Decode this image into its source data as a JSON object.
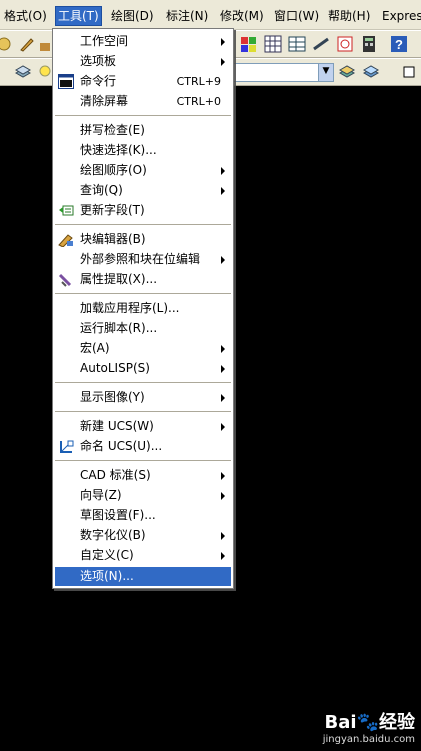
{
  "menubar": {
    "items": [
      {
        "label": "格式(O)"
      },
      {
        "label": "工具(T)"
      },
      {
        "label": "绘图(D)"
      },
      {
        "label": "标注(N)"
      },
      {
        "label": "修改(M)"
      },
      {
        "label": "窗口(W)"
      },
      {
        "label": "帮助(H)"
      },
      {
        "label": "Express"
      }
    ],
    "active_index": 1
  },
  "tools_menu": {
    "items": [
      {
        "label": "工作空间",
        "submenu": true
      },
      {
        "label": "选项板",
        "submenu": true
      },
      {
        "label": "命令行",
        "shortcut": "CTRL+9",
        "icon": "command-line-icon"
      },
      {
        "label": "清除屏幕",
        "shortcut": "CTRL+0"
      },
      {
        "label": "拼写检查(E)"
      },
      {
        "label": "快速选择(K)..."
      },
      {
        "label": "绘图顺序(O)",
        "submenu": true
      },
      {
        "label": "查询(Q)",
        "submenu": true
      },
      {
        "label": "更新字段(T)",
        "icon": "update-fields-icon"
      },
      {
        "label": "块编辑器(B)",
        "icon": "block-editor-icon"
      },
      {
        "label": "外部参照和块在位编辑",
        "submenu": true
      },
      {
        "label": "属性提取(X)...",
        "icon": "attribute-extract-icon"
      },
      {
        "label": "加载应用程序(L)..."
      },
      {
        "label": "运行脚本(R)..."
      },
      {
        "label": "宏(A)",
        "submenu": true
      },
      {
        "label": "AutoLISP(S)",
        "submenu": true
      },
      {
        "label": "显示图像(Y)",
        "submenu": true
      },
      {
        "label": "新建 UCS(W)",
        "submenu": true
      },
      {
        "label": "命名 UCS(U)...",
        "icon": "named-ucs-icon"
      },
      {
        "label": "CAD 标准(S)",
        "submenu": true
      },
      {
        "label": "向导(Z)",
        "submenu": true
      },
      {
        "label": "草图设置(F)..."
      },
      {
        "label": "数字化仪(B)",
        "submenu": true
      },
      {
        "label": "自定义(C)",
        "submenu": true
      },
      {
        "label": "选项(N)...",
        "selected": true
      }
    ]
  },
  "watermark": {
    "brand": "Bai",
    "brand_suffix": "经验",
    "url": "jingyan.baidu.com"
  },
  "colors": {
    "menu_bg": "#ece9d8",
    "highlight": "#316ac5",
    "canvas": "#000000"
  }
}
